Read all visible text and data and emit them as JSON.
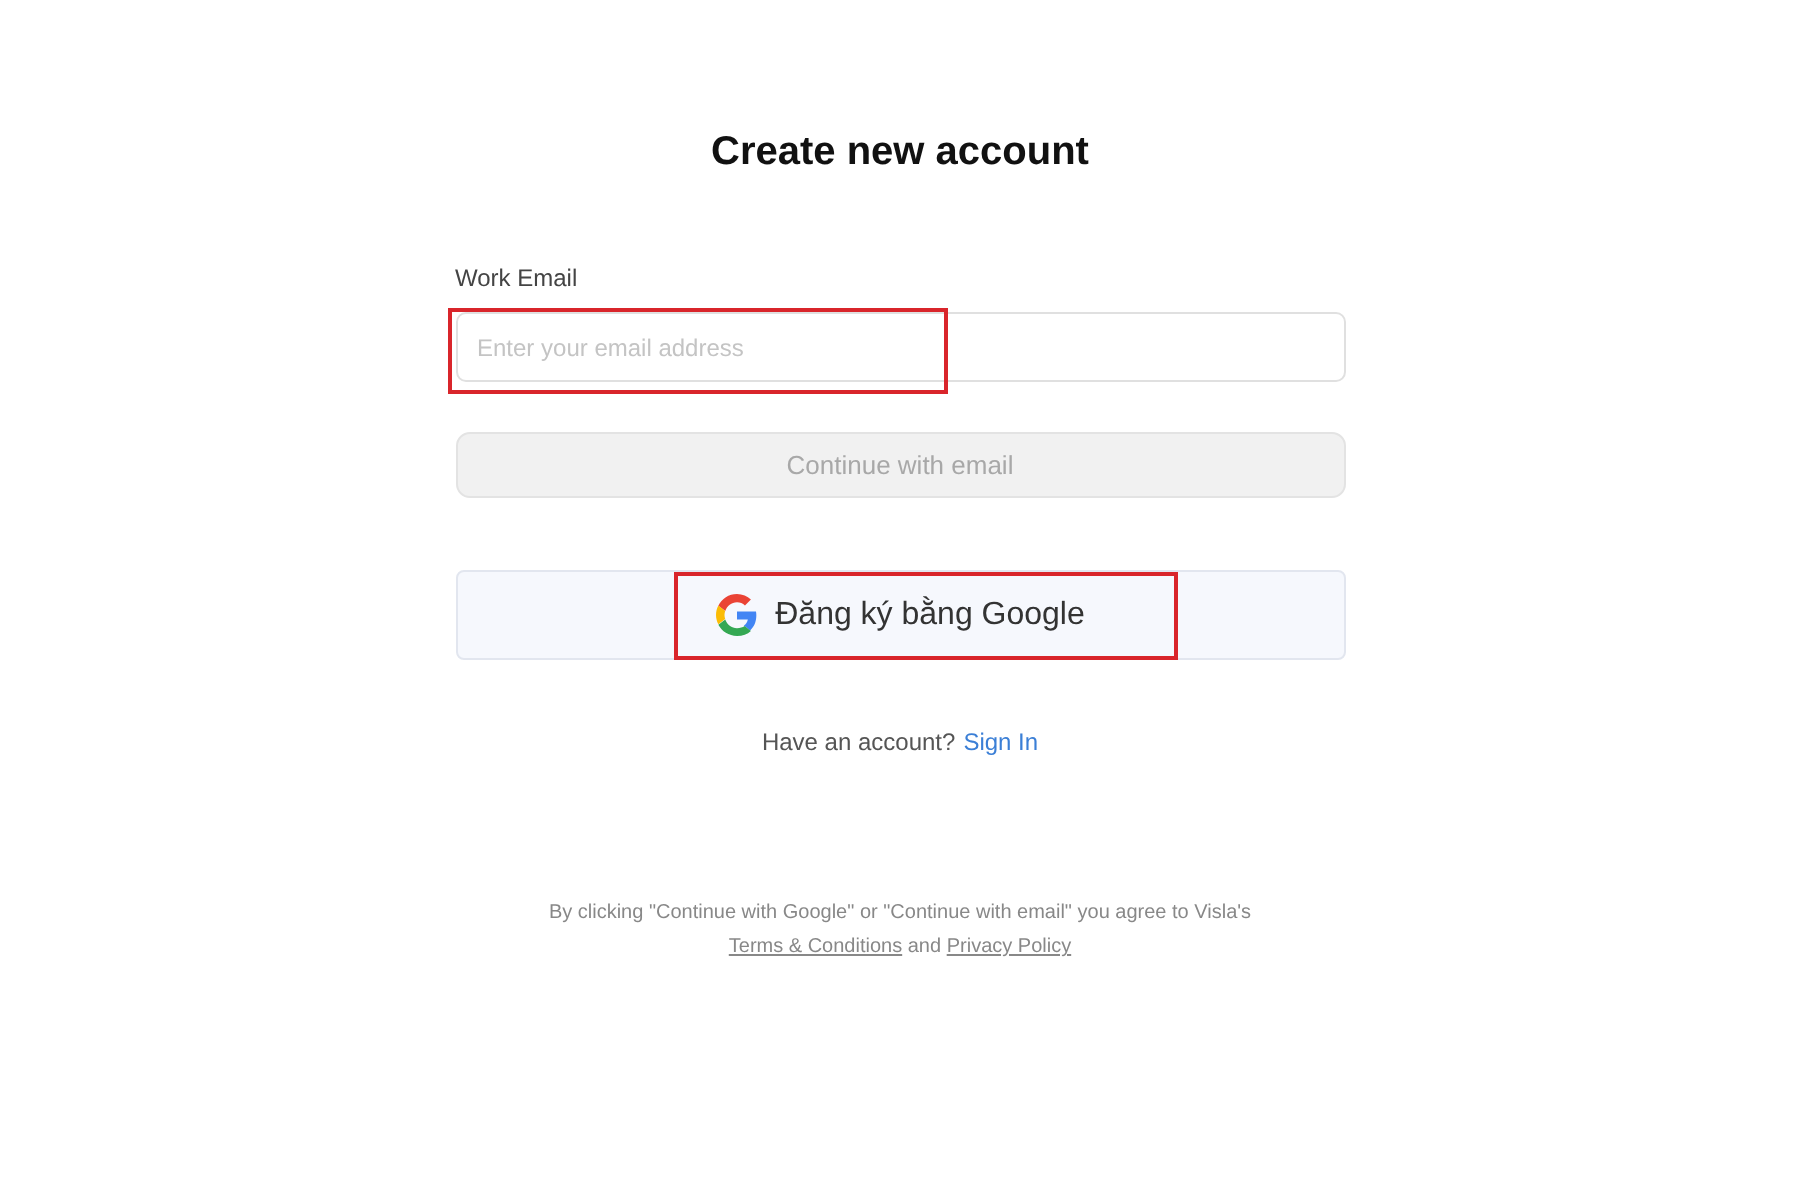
{
  "title": "Create new account",
  "email": {
    "label": "Work Email",
    "placeholder": "Enter your email address",
    "highlighted": true
  },
  "continue_button": {
    "label": "Continue with email",
    "disabled": true
  },
  "google_button": {
    "label": "Đăng ký bằng Google",
    "highlighted": true
  },
  "signin": {
    "prompt": "Have an account?",
    "link": "Sign In"
  },
  "legal": {
    "text": "By clicking \"Continue with Google\" or \"Continue with email\" you agree to Visla's",
    "terms_link": "Terms & Conditions",
    "joiner": "and",
    "privacy_link": "Privacy Policy"
  }
}
